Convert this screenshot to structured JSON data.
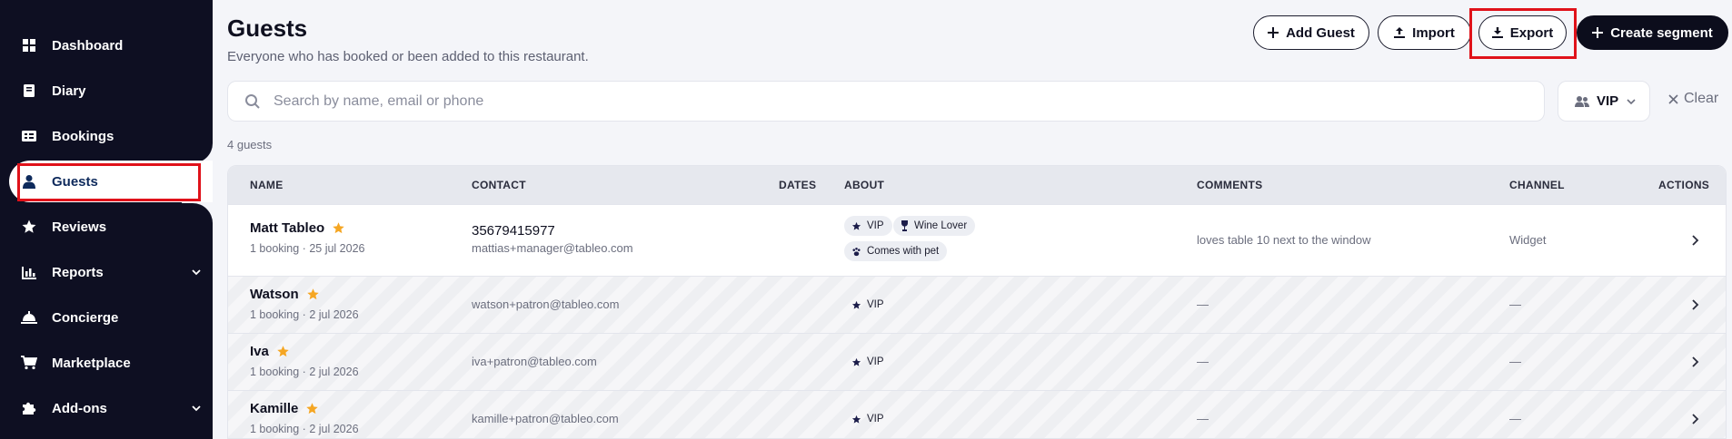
{
  "sidebar": {
    "items": [
      {
        "label": "Dashboard",
        "icon": "grid-icon"
      },
      {
        "label": "Diary",
        "icon": "book-icon"
      },
      {
        "label": "Bookings",
        "icon": "card-icon"
      },
      {
        "label": "Guests",
        "icon": "person-icon",
        "active": true
      },
      {
        "label": "Reviews",
        "icon": "star-icon"
      },
      {
        "label": "Reports",
        "icon": "chart-icon",
        "expandable": true
      },
      {
        "label": "Concierge",
        "icon": "bell-icon"
      },
      {
        "label": "Marketplace",
        "icon": "cart-icon"
      },
      {
        "label": "Add-ons",
        "icon": "puzzle-icon",
        "expandable": true
      }
    ]
  },
  "header": {
    "title": "Guests",
    "subtitle": "Everyone who has booked or been added to this restaurant.",
    "add_guest": "Add Guest",
    "import": "Import",
    "export": "Export",
    "create_segment": "Create segment"
  },
  "search": {
    "placeholder": "Search by name, email or phone",
    "value": ""
  },
  "filter": {
    "selected": "VIP"
  },
  "clear_label": "Clear",
  "count_label": "4 guests",
  "table": {
    "columns": [
      "NAME",
      "CONTACT",
      "DATES",
      "ABOUT",
      "COMMENTS",
      "CHANNEL",
      "ACTIONS"
    ],
    "rows": [
      {
        "name": "Matt Tableo",
        "sub": "1 booking · 25 jul 2026",
        "phone": "35679415977",
        "email": "mattias+manager@tableo.com",
        "tags": [
          "VIP",
          "Wine Lover",
          "Comes with pet"
        ],
        "comments": "loves table 10 next to the window",
        "channel": "Widget"
      },
      {
        "name": "Watson",
        "sub": "1 booking · 2 jul 2026",
        "email": "watson+patron@tableo.com",
        "tags": [
          "VIP"
        ],
        "comments": "—",
        "channel": "—"
      },
      {
        "name": "Iva",
        "sub": "1 booking · 2 jul 2026",
        "email": "iva+patron@tableo.com",
        "tags": [
          "VIP"
        ],
        "comments": "—",
        "channel": "—"
      },
      {
        "name": "Kamille",
        "sub": "1 booking · 2 jul 2026",
        "email": "kamille+patron@tableo.com",
        "tags": [
          "VIP"
        ],
        "comments": "—",
        "channel": "—"
      }
    ]
  },
  "colors": {
    "sidebar_bg": "#0e0f22",
    "star": "#f5a623",
    "highlight": "#e0121a",
    "primary_button": "#0c0d1c"
  }
}
